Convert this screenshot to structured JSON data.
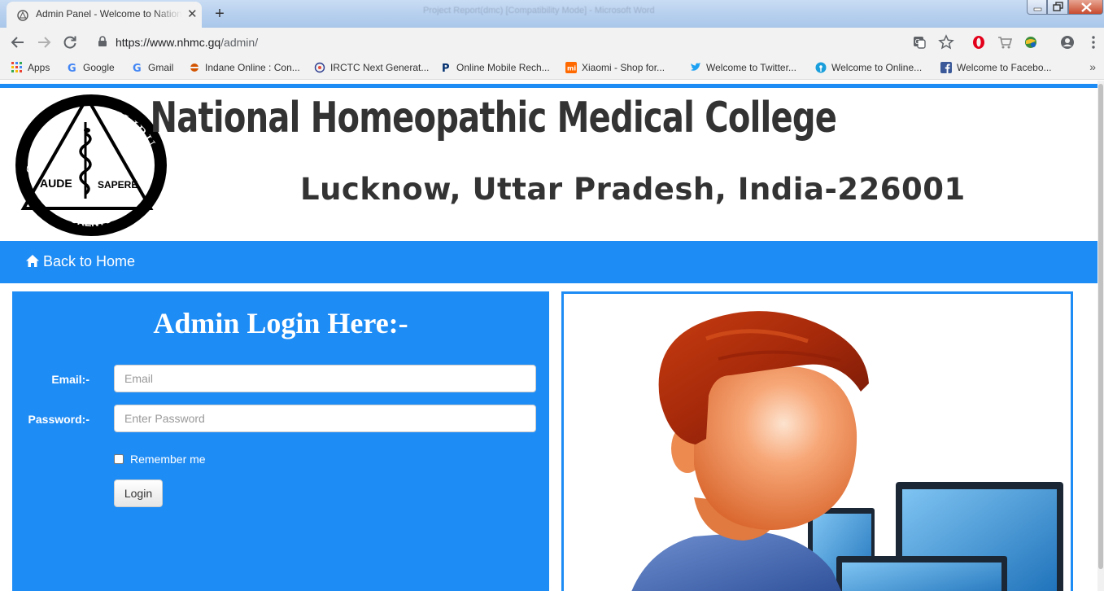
{
  "browser": {
    "tab_title": "Admin Panel - Welcome to National Homeopathic Medical College",
    "background_window_title": "Project Report(dmc) [Compatibility Mode] - Microsoft Word",
    "url_host": "https://www.nhmc.gq",
    "url_path": "/admin/",
    "bookmarks": [
      {
        "label": "Apps",
        "icon": "apps-grid-icon"
      },
      {
        "label": "Google",
        "icon": "google-icon"
      },
      {
        "label": "Gmail",
        "icon": "google-icon"
      },
      {
        "label": "Indane Online : Con...",
        "icon": "indane-icon"
      },
      {
        "label": "IRCTC Next Generat...",
        "icon": "irctc-icon"
      },
      {
        "label": "Online Mobile Rech...",
        "icon": "paytm-icon"
      },
      {
        "label": "Xiaomi - Shop for...",
        "icon": "mi-icon"
      },
      {
        "label": "Welcome to Twitter...",
        "icon": "twitter-icon"
      },
      {
        "label": "Welcome to Online...",
        "icon": "sbi-icon"
      },
      {
        "label": "Welcome to Facebo...",
        "icon": "facebook-icon"
      }
    ],
    "more_bookmarks": "»"
  },
  "header": {
    "college_name": "National Homeopathic Medical College",
    "address": "Lucknow, Uttar Pradesh, India-226001",
    "logo": {
      "top": "SIMILIA",
      "top_right": "SIMILIBUS",
      "left": "AUDE",
      "right": "SAPERE",
      "bottom": "CURENTUR"
    }
  },
  "nav": {
    "home_label": "Back to Home"
  },
  "login": {
    "heading": "Admin Login Here:-",
    "email_label": "Email:-",
    "email_placeholder": "Email",
    "password_label": "Password:-",
    "password_placeholder": "Enter Password",
    "remember_label": "Remember me",
    "button_label": "Login"
  },
  "colors": {
    "accent": "#1e8cf5",
    "heading_text": "#333333"
  }
}
